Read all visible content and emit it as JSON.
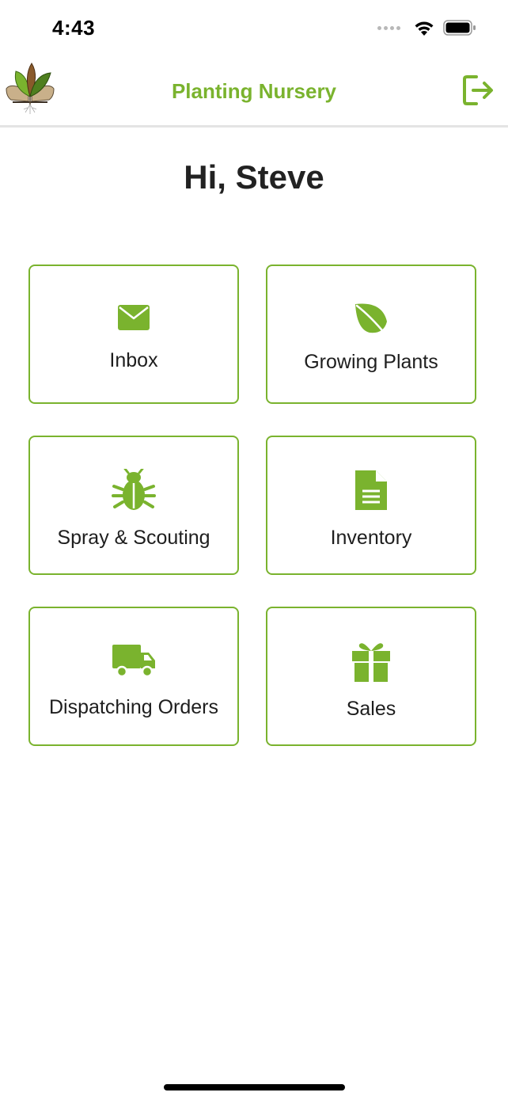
{
  "status_bar": {
    "time": "4:43",
    "icons": [
      "cellular-dots-icon",
      "wifi-icon",
      "battery-icon"
    ]
  },
  "nav": {
    "title": "Planting Nursery",
    "logo": "nursery-leaves-logo",
    "logout_icon": "logout-icon"
  },
  "greeting": "Hi, Steve",
  "tiles": [
    {
      "label": "Inbox",
      "icon": "envelope-icon"
    },
    {
      "label": "Growing Plants",
      "icon": "leaf-icon"
    },
    {
      "label": "Spray & Scouting",
      "icon": "bug-icon"
    },
    {
      "label": "Inventory",
      "icon": "document-icon"
    },
    {
      "label": "Dispatching Orders",
      "icon": "truck-icon"
    },
    {
      "label": "Sales",
      "icon": "gift-icon"
    }
  ],
  "colors": {
    "accent": "#7ab32e",
    "border": "#7ab32e",
    "text": "#222222",
    "divider": "#e4e4e4"
  }
}
